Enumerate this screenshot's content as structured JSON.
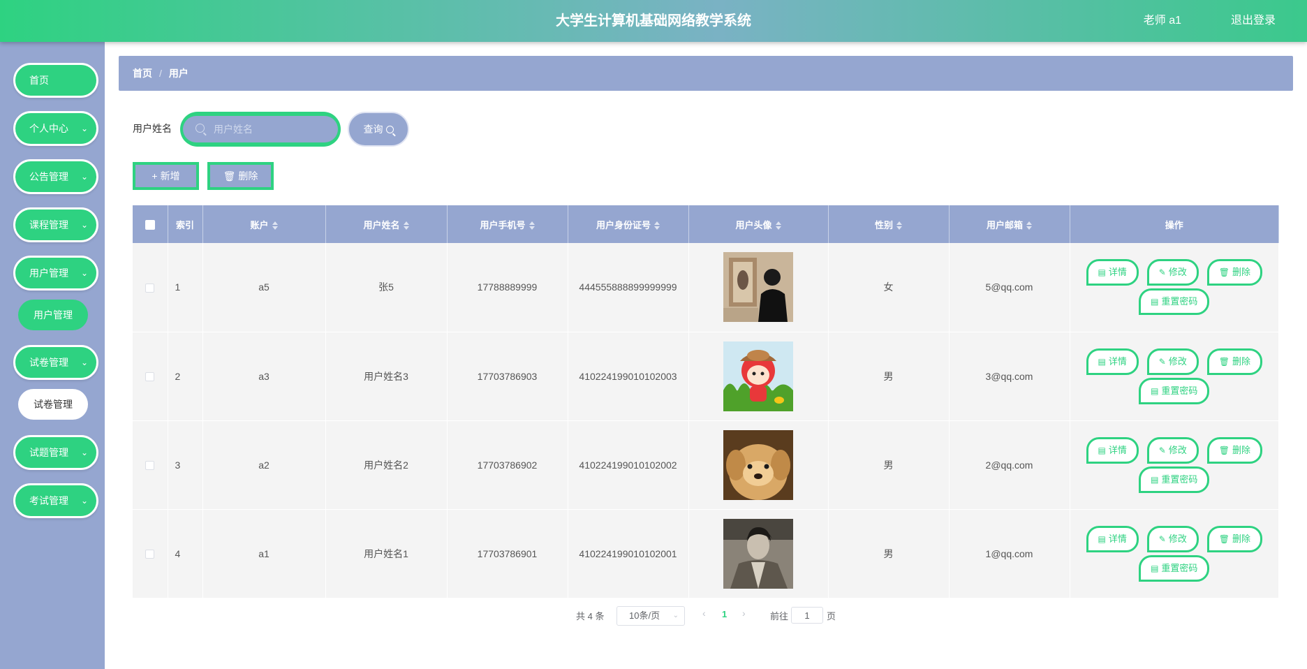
{
  "header": {
    "title": "大学生计算机基础网络教学系统",
    "user": "老师 a1",
    "logout": "退出登录"
  },
  "sidebar": {
    "items": [
      {
        "label": "首页"
      },
      {
        "label": "个人中心",
        "chevron": "chevron-down-icon"
      },
      {
        "label": "公告管理",
        "chevron": "chevron-down-icon"
      },
      {
        "label": "课程管理",
        "chevron": "chevron-down-icon"
      },
      {
        "label": "用户管理",
        "chevron": "chevron-down-icon"
      },
      {
        "label": "试卷管理",
        "chevron": "chevron-down-icon"
      },
      {
        "label": "试题管理",
        "chevron": "chevron-down-icon"
      },
      {
        "label": "考试管理",
        "chevron": "chevron-down-icon"
      }
    ],
    "sub_user": "用户管理",
    "sub_exam": "试卷管理"
  },
  "breadcrumb": {
    "home": "首页",
    "sep": "/",
    "current": "用户"
  },
  "search": {
    "label": "用户姓名",
    "placeholder": "用户姓名",
    "button": "查询"
  },
  "actions": {
    "add": "新增",
    "delete": "删除"
  },
  "table": {
    "headers": [
      "索引",
      "账户",
      "用户姓名",
      "用户手机号",
      "用户身份证号",
      "用户头像",
      "性别",
      "用户邮箱",
      "操作"
    ],
    "rows": [
      {
        "index": "1",
        "account": "a5",
        "name": "张5",
        "phone": "17788889999",
        "id_card": "444555888899999999",
        "avatar": "person-photo",
        "gender": "女",
        "email": "5@qq.com"
      },
      {
        "index": "2",
        "account": "a3",
        "name": "用户姓名3",
        "phone": "17703786903",
        "id_card": "410224199010102003",
        "avatar": "cartoon-fox",
        "gender": "男",
        "email": "3@qq.com"
      },
      {
        "index": "3",
        "account": "a2",
        "name": "用户姓名2",
        "phone": "17703786902",
        "id_card": "410224199010102002",
        "avatar": "puppy-photo",
        "gender": "男",
        "email": "2@qq.com"
      },
      {
        "index": "4",
        "account": "a1",
        "name": "用户姓名1",
        "phone": "17703786901",
        "id_card": "410224199010102001",
        "avatar": "man-portrait",
        "gender": "男",
        "email": "1@qq.com"
      }
    ],
    "ops": {
      "detail": "详情",
      "edit": "修改",
      "delete": "删除",
      "reset": "重置密码"
    }
  },
  "pagination": {
    "total": "共 4 条",
    "page_size": "10条/页",
    "current": "1",
    "goto": "前往",
    "goto_value": "1",
    "page": "页"
  },
  "colors": {
    "accent": "#2ed281",
    "panel": "#95a6d0"
  }
}
